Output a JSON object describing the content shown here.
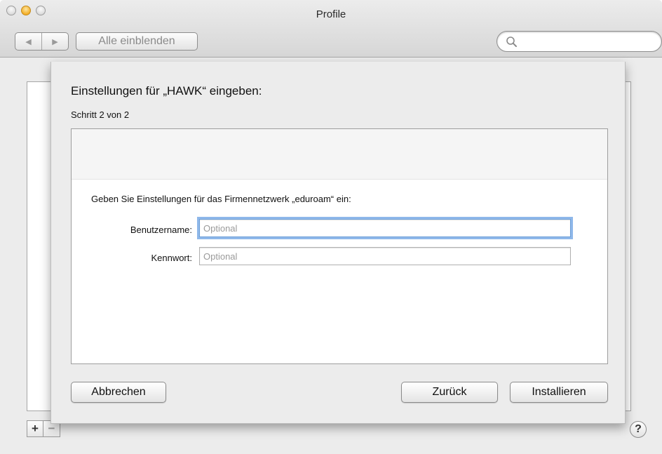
{
  "window": {
    "title": "Profile"
  },
  "toolbar": {
    "back_glyph": "◀",
    "forward_glyph": "▶",
    "show_all_label": "Alle einblenden",
    "search_placeholder": ""
  },
  "sheet": {
    "title": "Einstellungen für „HAWK“ eingeben:",
    "step": "Schritt 2 von 2",
    "instruction": "Geben Sie Einstellungen für das Firmennetzwerk „eduroam“ ein:",
    "fields": [
      {
        "label": "Benutzername:",
        "placeholder": "Optional",
        "value": ""
      },
      {
        "label": "Kennwort:",
        "placeholder": "Optional",
        "value": ""
      }
    ],
    "buttons": {
      "cancel": "Abbrechen",
      "back": "Zurück",
      "install": "Installieren"
    }
  },
  "bottom": {
    "add_label": "+",
    "remove_label": "−",
    "help_label": "?"
  },
  "colors": {
    "focus_ring": "#8fb8ea",
    "minimize_light": "#f3ae27"
  }
}
